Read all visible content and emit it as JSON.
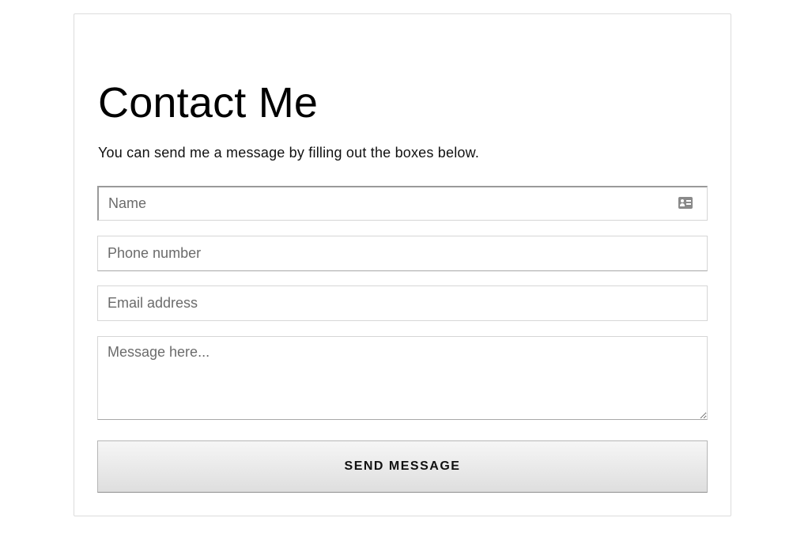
{
  "form": {
    "title": "Contact Me",
    "subtitle": "You can send me a message by filling out the boxes below.",
    "fields": {
      "name": {
        "placeholder": "Name",
        "value": "",
        "icon": "contact-card-icon"
      },
      "phone": {
        "placeholder": "Phone number",
        "value": ""
      },
      "email": {
        "placeholder": "Email address",
        "value": ""
      },
      "message": {
        "placeholder": "Message here...",
        "value": ""
      }
    },
    "submit_label": "SEND MESSAGE"
  },
  "colors": {
    "border": "#d6d6d6",
    "focus_border": "#9a9a9a",
    "button_top": "#f6f6f6",
    "button_bottom": "#dedede",
    "text": "#111111",
    "placeholder": "#6b6b6b"
  }
}
